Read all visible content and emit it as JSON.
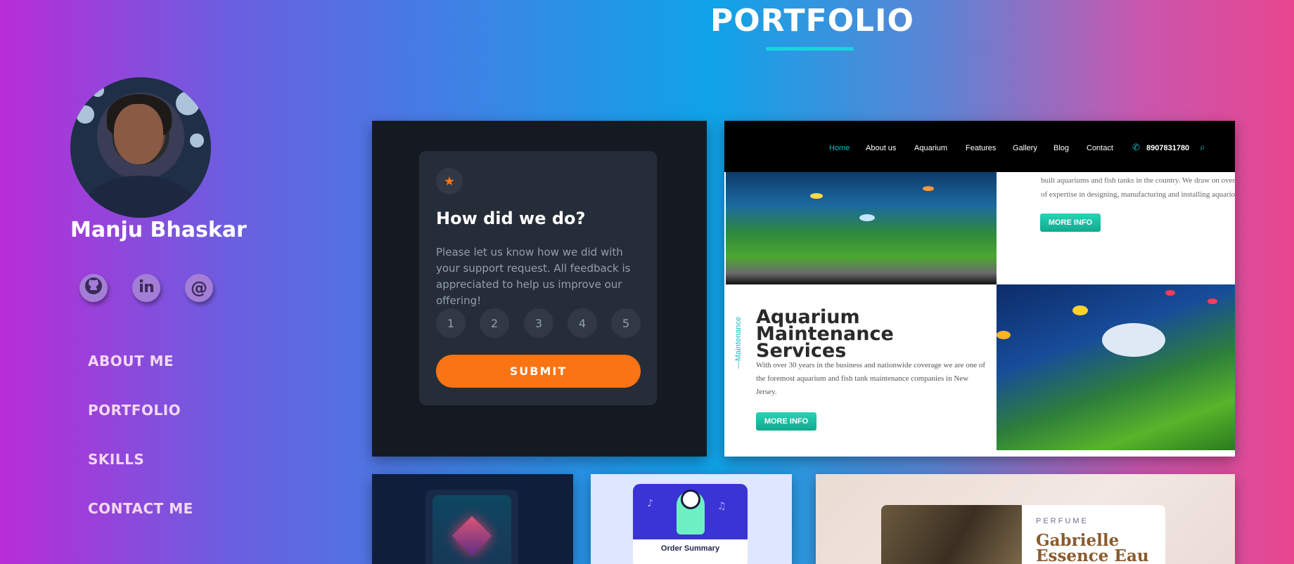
{
  "page": {
    "title": "PORTFOLIO"
  },
  "profile": {
    "name": "Manju Bhaskar"
  },
  "social": [
    {
      "icon": "github-icon"
    },
    {
      "icon": "linkedin-icon"
    },
    {
      "icon": "email-icon"
    }
  ],
  "nav": {
    "about": "ABOUT ME",
    "portfolio": "PORTFOLIO",
    "skills": "SKILLS",
    "contact": "CONTACT ME"
  },
  "feedback_card": {
    "heading": "How did we do?",
    "text": "Please let us know how we did with your support request. All feedback is appreciated to help us improve our offering!",
    "ratings": [
      "1",
      "2",
      "3",
      "4",
      "5"
    ],
    "submit": "SUBMIT",
    "accent": "#fb7413"
  },
  "aquarium_card": {
    "nav": [
      "Home",
      "About us",
      "Aquarium",
      "Features",
      "Gallery",
      "Blog",
      "Contact"
    ],
    "phone": "8907831780",
    "top_text_1": "built aquariums and fish tanks in the country. We draw on over",
    "top_text_2": "of expertise in designing, manufacturing and installing aquario",
    "more_info": "MORE INFO",
    "vertical_label": "—Maintenance",
    "heading": "Aquarium Maintenance Services",
    "paragraph": "With over 30 years in the business and nationwide coverage we are one of the foremost aquarium and fish tank maintenance companies in New Jersey.",
    "accent": "#19b7c8"
  },
  "order_card": {
    "title": "Order Summary"
  },
  "perfume_card": {
    "category": "PERFUME",
    "name": "Gabrielle Essence Eau"
  }
}
